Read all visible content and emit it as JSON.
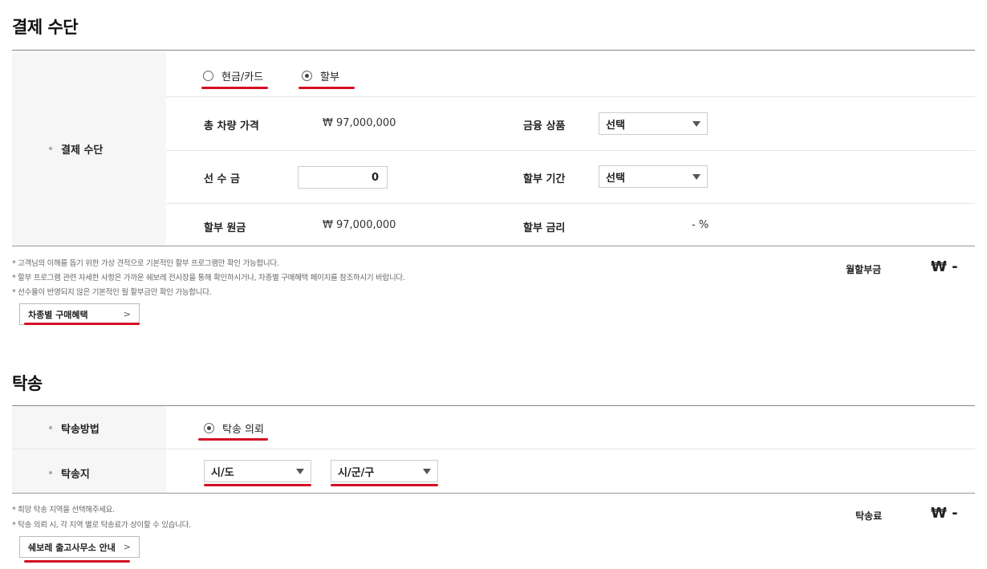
{
  "payment": {
    "title": "결제 수단",
    "row_label": "결제 수단",
    "options": [
      {
        "label": "현금/카드",
        "selected": false
      },
      {
        "label": "할부",
        "selected": true
      }
    ],
    "total_price_label": "총 차량 가격",
    "total_price_value": "₩ 97,000,000",
    "finance_product_label": "금융 상품",
    "finance_product_value": "선택",
    "down_payment_label": "선 수 금",
    "down_payment_value": "0",
    "installment_period_label": "할부 기간",
    "installment_period_value": "선택",
    "principal_label": "할부 원금",
    "principal_value": "₩ 97,000,000",
    "rate_label": "할부 금리",
    "rate_value": "- %",
    "notes": [
      "* 고객님의 이해를 돕기 위한 가상 견적으로 기본적인 할부 프로그램만 확인 가능합니다.",
      "* 할부 프로그램 관련 자세한 사항은 가까운 쉐보레 전시장을 통해 확인하시거나, 차종별 구매혜택 페이지를 참조하시기 바랍니다.",
      "* 선수율이 반영되지 않은 기본적인 월 할부금만 확인 가능합니다."
    ],
    "benefit_button": "차종별 구매혜택",
    "monthly_label": "월할부금",
    "monthly_value": "₩ -"
  },
  "delivery": {
    "title": "탁송",
    "method_label": "탁송방법",
    "method_option": "탁송 의뢰",
    "location_label": "탁송지",
    "province_value": "시/도",
    "city_value": "시/군/구",
    "notes": [
      "* 희망 탁송 지역을 선택해주세요.",
      "* 탁송 의뢰 시, 각 지역 별로 탁송료가 상이할 수 있습니다."
    ],
    "office_button": "쉐보레 출고사무소 안내",
    "fee_label": "탁송료",
    "fee_value": "₩ -"
  },
  "colors": {
    "accent_red": "#d50f25",
    "label_bg": "#f6f6f6"
  }
}
